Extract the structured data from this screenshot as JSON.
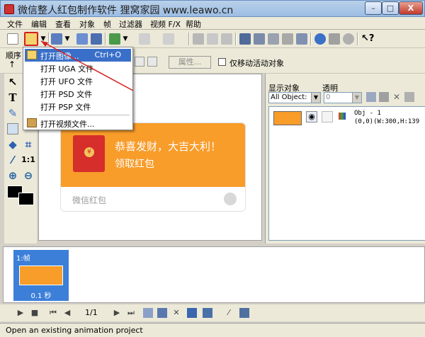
{
  "window": {
    "title": "微信整人红包制作软件   狸窝家园 www.leawo.cn",
    "minimize": "–",
    "maximize": "□",
    "close": "X"
  },
  "menubar": [
    "文件",
    "编辑",
    "查看",
    "对象",
    "帧",
    "过滤器",
    "视频 F/X",
    "帮助"
  ],
  "toolbar2": {
    "order_label": "顺序",
    "properties_button": "属性...",
    "move_active_checkbox": "仅移动活动对象",
    "move_active_checked": false
  },
  "file_dropdown": {
    "items": [
      {
        "label": "打开图像...",
        "shortcut": "Ctrl+O",
        "highlighted": true
      },
      {
        "label": "打开 UGA 文件",
        "shortcut": "",
        "highlighted": false
      },
      {
        "label": "打开 UFO 文件",
        "shortcut": "",
        "highlighted": false
      },
      {
        "label": "打开 PSD 文件",
        "shortcut": "",
        "highlighted": false
      },
      {
        "label": "打开 PSP 文件",
        "shortcut": "",
        "highlighted": false
      },
      {
        "label": "打开视频文件...",
        "shortcut": "",
        "highlighted": false
      }
    ]
  },
  "palette": {
    "text_tool": "T",
    "one_to_one": "1:1"
  },
  "canvas": {
    "envelope": {
      "seal": "¥",
      "title": "恭喜发财，大吉大利！",
      "subtitle": "领取红包",
      "footer": "微信红包"
    }
  },
  "right_panel": {
    "show_objects_label": "显示对象",
    "transparency_label": "透明",
    "objects_select": "All Object:",
    "transparency_value": "0",
    "object": {
      "name": "Obj - 1",
      "info": "(0,0)(W:300,H:139"
    }
  },
  "timeline": {
    "frame_label": "1:帧",
    "frame_delay": "0.1 秒",
    "page_counter": "1/1"
  },
  "status": {
    "text": "Open an existing animation project"
  },
  "colors": {
    "envelope_orange": "#f89c2a",
    "envelope_red": "#d52e2b",
    "selection_blue": "#3a6fc9",
    "annotation_red": "#d42020"
  }
}
